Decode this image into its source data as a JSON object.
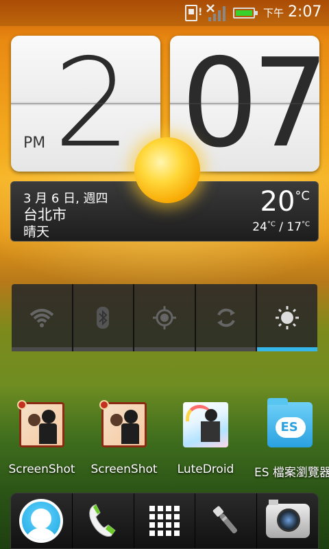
{
  "status_bar": {
    "ampm": "下午",
    "time": "2:07",
    "icons": [
      "sim-card-icon",
      "no-signal-icon",
      "battery-icon"
    ],
    "battery_color": "#39d12c"
  },
  "clock": {
    "hour": "2",
    "minute": "07",
    "period": "PM"
  },
  "weather": {
    "date": "3 月 6 日, 週四",
    "city": "台北市",
    "condition": "晴天",
    "temperature": "20",
    "unit": "°C",
    "high": "24",
    "low": "17",
    "range_unit": "°C",
    "separator": "/",
    "icon": "sun-icon"
  },
  "quick_settings": {
    "items": [
      {
        "icon": "wifi-icon",
        "state": "off"
      },
      {
        "icon": "bluetooth-icon",
        "state": "off"
      },
      {
        "icon": "gps-icon",
        "state": "off"
      },
      {
        "icon": "sync-icon",
        "state": "off"
      },
      {
        "icon": "brightness-icon",
        "state": "on"
      }
    ],
    "active_color": "#37b6ea"
  },
  "apps": [
    {
      "label": "ScreenShot",
      "icon": "screenshot-app-icon"
    },
    {
      "label": "ScreenShot",
      "icon": "screenshot-app-icon"
    },
    {
      "label": "LuteDroid",
      "icon": "lutedroid-app-icon"
    },
    {
      "label": "ES 檔案瀏覽器",
      "icon": "es-file-explorer-icon"
    }
  ],
  "dock": {
    "items": [
      "people-icon",
      "phone-icon",
      "all-apps-icon",
      "flashlight-icon",
      "camera-icon"
    ]
  }
}
